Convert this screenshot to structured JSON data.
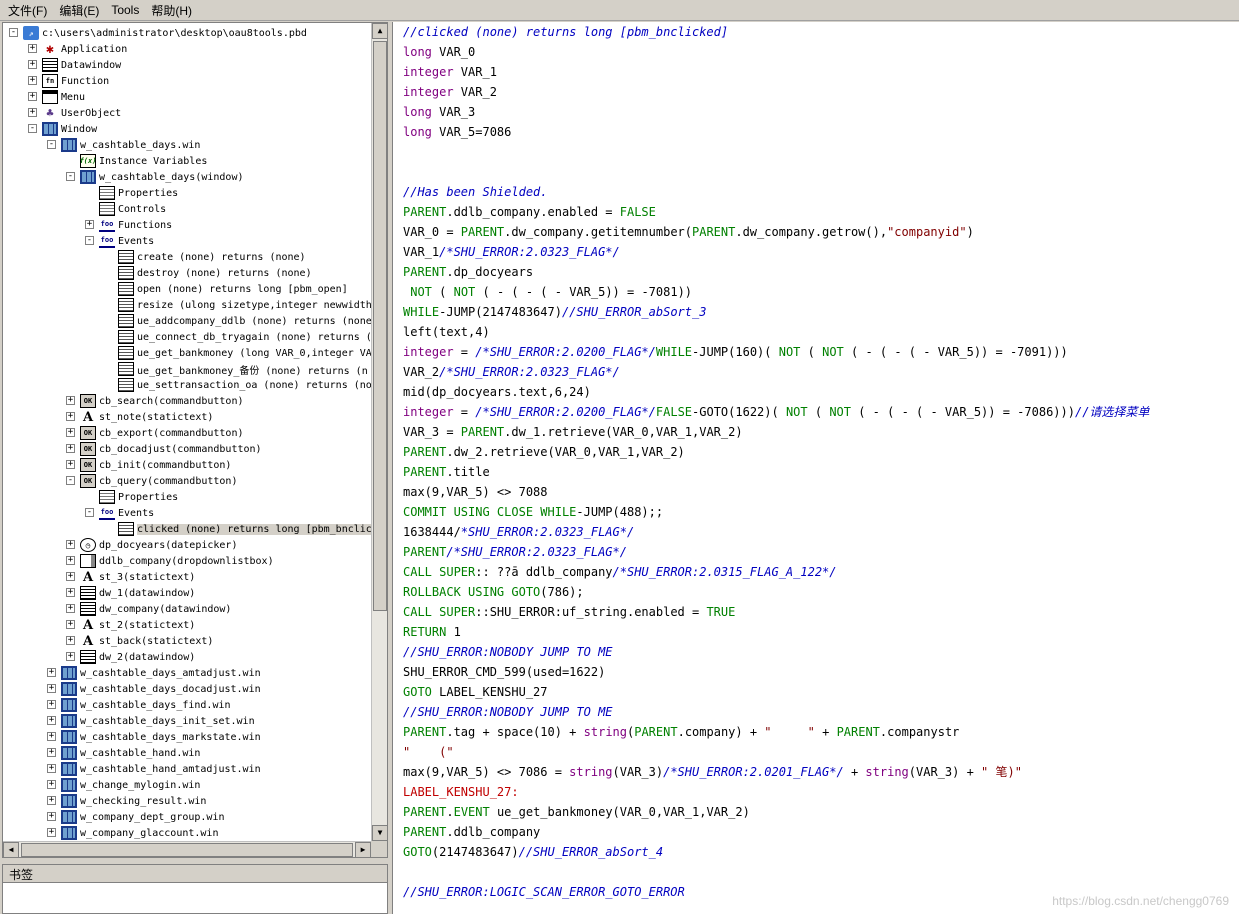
{
  "menubar": {
    "items": [
      "文件(F)",
      "编辑(E)",
      "Tools",
      "帮助(H)"
    ]
  },
  "tree": {
    "rows": [
      {
        "label": "c:\\users\\administrator\\desktop\\oau8tools.pbd",
        "icon": "pbd-icon",
        "level": 0,
        "exp": "-"
      },
      {
        "label": "Application",
        "icon": "app-icon",
        "level": 1,
        "exp": "+"
      },
      {
        "label": "Datawindow",
        "icon": "dw-icon",
        "level": 1,
        "exp": "+"
      },
      {
        "label": "Function",
        "icon": "fn-icon",
        "level": 1,
        "exp": "+"
      },
      {
        "label": "Menu",
        "icon": "menu-icon",
        "level": 1,
        "exp": "+"
      },
      {
        "label": "UserObject",
        "icon": "uo-icon",
        "level": 1,
        "exp": "+"
      },
      {
        "label": "Window",
        "icon": "win-icon",
        "level": 1,
        "exp": "-"
      },
      {
        "label": "w_cashtable_days.win",
        "icon": "win-icon",
        "level": 2,
        "exp": "-"
      },
      {
        "label": "Instance Variables",
        "icon": "var-icon",
        "level": 3,
        "exp": ""
      },
      {
        "label": "w_cashtable_days(window)",
        "icon": "win-icon",
        "level": 3,
        "exp": "-"
      },
      {
        "label": "Properties",
        "icon": "prop-icon",
        "level": 4,
        "exp": ""
      },
      {
        "label": "Controls",
        "icon": "prop-icon",
        "level": 4,
        "exp": ""
      },
      {
        "label": "Functions",
        "icon": "foo-icon",
        "level": 4,
        "exp": "+"
      },
      {
        "label": "Events",
        "icon": "foo-icon",
        "level": 4,
        "exp": "-"
      },
      {
        "label": "create (none) returns (none)",
        "icon": "ev-icon",
        "level": 5,
        "exp": ""
      },
      {
        "label": "destroy (none) returns (none)",
        "icon": "ev-icon",
        "level": 5,
        "exp": ""
      },
      {
        "label": "open (none) returns long [pbm_open]",
        "icon": "ev-icon",
        "level": 5,
        "exp": ""
      },
      {
        "label": "resize (ulong sizetype,integer newwidth",
        "icon": "ev-icon",
        "level": 5,
        "exp": ""
      },
      {
        "label": "ue_addcompany_ddlb (none) returns (none",
        "icon": "ev-icon",
        "level": 5,
        "exp": ""
      },
      {
        "label": "ue_connect_db_tryagain (none) returns (",
        "icon": "ev-icon",
        "level": 5,
        "exp": ""
      },
      {
        "label": "ue_get_bankmoney (long VAR_0,integer VA",
        "icon": "ev-icon",
        "level": 5,
        "exp": ""
      },
      {
        "label": "ue_get_bankmoney_备份 (none) returns (n",
        "icon": "ev-icon",
        "level": 5,
        "exp": ""
      },
      {
        "label": "ue_settransaction_oa (none) returns (no",
        "icon": "ev-icon",
        "level": 5,
        "exp": ""
      },
      {
        "label": "cb_search(commandbutton)",
        "icon": "ok-icon",
        "level": 3,
        "exp": "+"
      },
      {
        "label": "st_note(statictext)",
        "icon": "a-icon",
        "level": 3,
        "exp": "+"
      },
      {
        "label": "cb_export(commandbutton)",
        "icon": "ok-icon",
        "level": 3,
        "exp": "+"
      },
      {
        "label": "cb_docadjust(commandbutton)",
        "icon": "ok-icon",
        "level": 3,
        "exp": "+"
      },
      {
        "label": "cb_init(commandbutton)",
        "icon": "ok-icon",
        "level": 3,
        "exp": "+"
      },
      {
        "label": "cb_query(commandbutton)",
        "icon": "ok-icon",
        "level": 3,
        "exp": "-"
      },
      {
        "label": "Properties",
        "icon": "prop-icon",
        "level": 4,
        "exp": ""
      },
      {
        "label": "Events",
        "icon": "foo-icon",
        "level": 4,
        "exp": "-"
      },
      {
        "label": "clicked (none) returns long [pbm_bnclic",
        "icon": "ev-icon",
        "level": 5,
        "exp": "",
        "selected": true
      },
      {
        "label": "dp_docyears(datepicker)",
        "icon": "dp-icon",
        "level": 3,
        "exp": "+"
      },
      {
        "label": "ddlb_company(dropdownlistbox)",
        "icon": "ddlb-icon",
        "level": 3,
        "exp": "+"
      },
      {
        "label": "st_3(statictext)",
        "icon": "a-icon",
        "level": 3,
        "exp": "+"
      },
      {
        "label": "dw_1(datawindow)",
        "icon": "dw-icon",
        "level": 3,
        "exp": "+"
      },
      {
        "label": "dw_company(datawindow)",
        "icon": "dw-icon",
        "level": 3,
        "exp": "+"
      },
      {
        "label": "st_2(statictext)",
        "icon": "a-icon",
        "level": 3,
        "exp": "+"
      },
      {
        "label": "st_back(statictext)",
        "icon": "a-icon",
        "level": 3,
        "exp": "+"
      },
      {
        "label": "dw_2(datawindow)",
        "icon": "dw-icon",
        "level": 3,
        "exp": "+"
      },
      {
        "label": "w_cashtable_days_amtadjust.win",
        "icon": "win-icon",
        "level": 2,
        "exp": "+"
      },
      {
        "label": "w_cashtable_days_docadjust.win",
        "icon": "win-icon",
        "level": 2,
        "exp": "+"
      },
      {
        "label": "w_cashtable_days_find.win",
        "icon": "win-icon",
        "level": 2,
        "exp": "+"
      },
      {
        "label": "w_cashtable_days_init_set.win",
        "icon": "win-icon",
        "level": 2,
        "exp": "+"
      },
      {
        "label": "w_cashtable_days_markstate.win",
        "icon": "win-icon",
        "level": 2,
        "exp": "+"
      },
      {
        "label": "w_cashtable_hand.win",
        "icon": "win-icon",
        "level": 2,
        "exp": "+"
      },
      {
        "label": "w_cashtable_hand_amtadjust.win",
        "icon": "win-icon",
        "level": 2,
        "exp": "+"
      },
      {
        "label": "w_change_mylogin.win",
        "icon": "win-icon",
        "level": 2,
        "exp": "+"
      },
      {
        "label": "w_checking_result.win",
        "icon": "win-icon",
        "level": 2,
        "exp": "+"
      },
      {
        "label": "w_company_dept_group.win",
        "icon": "win-icon",
        "level": 2,
        "exp": "+"
      },
      {
        "label": "w_company_glaccount.win",
        "icon": "win-icon",
        "level": 2,
        "exp": "+"
      }
    ]
  },
  "bookmark": {
    "title": "书签"
  },
  "editor": {
    "lines": [
      [
        [
          "cmt",
          "//clicked (none) returns long [pbm_bnclicked]"
        ]
      ],
      [
        [
          "kw",
          "long"
        ],
        [
          "plain",
          " VAR_0"
        ]
      ],
      [
        [
          "kw",
          "integer"
        ],
        [
          "plain",
          " VAR_1"
        ]
      ],
      [
        [
          "kw",
          "integer"
        ],
        [
          "plain",
          " VAR_2"
        ]
      ],
      [
        [
          "kw",
          "long"
        ],
        [
          "plain",
          " VAR_3"
        ]
      ],
      [
        [
          "kw",
          "long"
        ],
        [
          "plain",
          " VAR_5=7086"
        ]
      ],
      [],
      [],
      [
        [
          "cmt",
          "//Has been Shielded."
        ]
      ],
      [
        [
          "green",
          "PARENT"
        ],
        [
          "plain",
          ".ddlb_company.enabled = "
        ],
        [
          "green",
          "FALSE"
        ]
      ],
      [
        [
          "plain",
          "VAR_0 = "
        ],
        [
          "green",
          "PARENT"
        ],
        [
          "plain",
          ".dw_company.getitemnumber("
        ],
        [
          "green",
          "PARENT"
        ],
        [
          "plain",
          ".dw_company.getrow(),"
        ],
        [
          "str",
          "\"companyid\""
        ],
        [
          "plain",
          ")"
        ]
      ],
      [
        [
          "plain",
          "VAR_1"
        ],
        [
          "cmt",
          "/*SHU_ERROR:2.0323_FLAG*/"
        ]
      ],
      [
        [
          "green",
          "PARENT"
        ],
        [
          "plain",
          ".dp_docyears"
        ]
      ],
      [
        [
          "green",
          " NOT"
        ],
        [
          "plain",
          " ( "
        ],
        [
          "green",
          "NOT"
        ],
        [
          "plain",
          " ( - ( - ( - VAR_5)) = -7081))"
        ]
      ],
      [
        [
          "green",
          "WHILE"
        ],
        [
          "plain",
          "-JUMP(2147483647)"
        ],
        [
          "cmt",
          "//SHU_ERROR_abSort_3"
        ]
      ],
      [
        [
          "plain",
          "left(text,4)"
        ]
      ],
      [
        [
          "kw",
          "integer"
        ],
        [
          "plain",
          " = "
        ],
        [
          "cmt",
          "/*SHU_ERROR:2.0200_FLAG*/"
        ],
        [
          "green",
          "WHILE"
        ],
        [
          "plain",
          "-JUMP(160)( "
        ],
        [
          "green",
          "NOT"
        ],
        [
          "plain",
          " ( "
        ],
        [
          "green",
          "NOT"
        ],
        [
          "plain",
          " ( - ( - ( - VAR_5)) = -7091)))"
        ]
      ],
      [
        [
          "plain",
          "VAR_2"
        ],
        [
          "cmt",
          "/*SHU_ERROR:2.0323_FLAG*/"
        ]
      ],
      [
        [
          "plain",
          "mid(dp_docyears.text,6,24)"
        ]
      ],
      [
        [
          "kw",
          "integer"
        ],
        [
          "plain",
          " = "
        ],
        [
          "cmt",
          "/*SHU_ERROR:2.0200_FLAG*/"
        ],
        [
          "green",
          "FALSE"
        ],
        [
          "plain",
          "-GOTO(1622)( "
        ],
        [
          "green",
          "NOT"
        ],
        [
          "plain",
          " ( "
        ],
        [
          "green",
          "NOT"
        ],
        [
          "plain",
          " ( - ( - ( - VAR_5)) = -7086)))"
        ],
        [
          "cmt",
          "//请选择菜单"
        ]
      ],
      [
        [
          "plain",
          "VAR_3 = "
        ],
        [
          "green",
          "PARENT"
        ],
        [
          "plain",
          ".dw_1.retrieve(VAR_0,VAR_1,VAR_2)"
        ]
      ],
      [
        [
          "green",
          "PARENT"
        ],
        [
          "plain",
          ".dw_2.retrieve(VAR_0,VAR_1,VAR_2)"
        ]
      ],
      [
        [
          "green",
          "PARENT"
        ],
        [
          "plain",
          ".title"
        ]
      ],
      [
        [
          "plain",
          "max(9,VAR_5) <> 7088"
        ]
      ],
      [
        [
          "green",
          "COMMIT USING CLOSE WHILE"
        ],
        [
          "plain",
          "-JUMP(488);;"
        ]
      ],
      [
        [
          "plain",
          "1638444/"
        ],
        [
          "cmt",
          "*SHU_ERROR:2.0323_FLAG*/"
        ]
      ],
      [
        [
          "green",
          "PARENT"
        ],
        [
          "cmt",
          "/*SHU_ERROR:2.0323_FLAG*/"
        ]
      ],
      [
        [
          "green",
          "CALL SUPER"
        ],
        [
          "plain",
          ":: ??ā ddlb_company"
        ],
        [
          "cmt",
          "/*SHU_ERROR:2.0315_FLAG_A_122*/"
        ]
      ],
      [
        [
          "green",
          "ROLLBACK USING GOTO"
        ],
        [
          "plain",
          "(786);"
        ]
      ],
      [
        [
          "green",
          "CALL SUPER"
        ],
        [
          "plain",
          "::SHU_ERROR:uf_string.enabled = "
        ],
        [
          "green",
          "TRUE"
        ]
      ],
      [
        [
          "green",
          "RETURN"
        ],
        [
          "plain",
          " 1"
        ]
      ],
      [
        [
          "cmt",
          "//SHU_ERROR:NOBODY JUMP TO ME"
        ]
      ],
      [
        [
          "plain",
          "SHU_ERROR_CMD_599(used=1622)"
        ]
      ],
      [
        [
          "green",
          "GOTO"
        ],
        [
          "plain",
          " LABEL_KENSHU_27"
        ]
      ],
      [
        [
          "cmt",
          "//SHU_ERROR:NOBODY JUMP TO ME"
        ]
      ],
      [
        [
          "green",
          "PARENT"
        ],
        [
          "plain",
          ".tag + space(10) + "
        ],
        [
          "kw",
          "string"
        ],
        [
          "plain",
          "("
        ],
        [
          "green",
          "PARENT"
        ],
        [
          "plain",
          ".company) + "
        ],
        [
          "str",
          "\"     \""
        ],
        [
          "plain",
          " + "
        ],
        [
          "green",
          "PARENT"
        ],
        [
          "plain",
          ".companystr"
        ]
      ],
      [
        [
          "str",
          "\"    (\""
        ]
      ],
      [
        [
          "plain",
          "max(9,VAR_5) <> 7086 = "
        ],
        [
          "kw",
          "string"
        ],
        [
          "plain",
          "(VAR_3)"
        ],
        [
          "cmt",
          "/*SHU_ERROR:2.0201_FLAG*/"
        ],
        [
          "plain",
          " + "
        ],
        [
          "kw",
          "string"
        ],
        [
          "plain",
          "(VAR_3) + "
        ],
        [
          "str",
          "\" 笔)\""
        ]
      ],
      [
        [
          "red",
          "LABEL_KENSHU_27:"
        ]
      ],
      [
        [
          "green",
          "PARENT"
        ],
        [
          "plain",
          "."
        ],
        [
          "green",
          "EVENT"
        ],
        [
          "plain",
          " ue_get_bankmoney(VAR_0,VAR_1,VAR_2)"
        ]
      ],
      [
        [
          "green",
          "PARENT"
        ],
        [
          "plain",
          ".ddlb_company"
        ]
      ],
      [
        [
          "green",
          "GOTO"
        ],
        [
          "plain",
          "(2147483647)"
        ],
        [
          "cmt",
          "//SHU_ERROR_abSort_4"
        ]
      ],
      [],
      [
        [
          "cmt",
          "//SHU_ERROR:LOGIC_SCAN_ERROR_GOTO_ERROR"
        ]
      ]
    ]
  },
  "watermark": "https://blog.csdn.net/chengg0769"
}
